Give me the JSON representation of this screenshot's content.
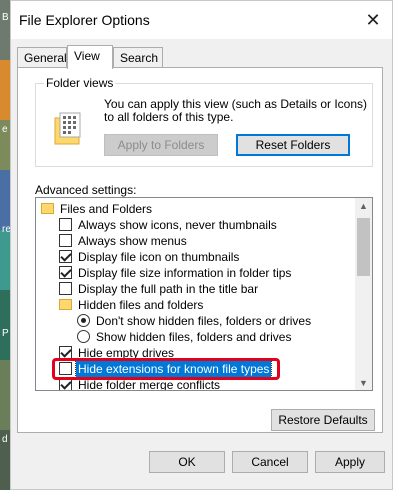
{
  "desktop": {
    "label_1": "B",
    "label_2": "e",
    "label_3": "re",
    "label_4": "P",
    "label_5": "d"
  },
  "window": {
    "title": "File Explorer Options",
    "close_glyph": "✕"
  },
  "tabs": [
    {
      "label": "General"
    },
    {
      "label": "View"
    },
    {
      "label": "Search"
    }
  ],
  "folder_views": {
    "legend": "Folder views",
    "description": "You can apply this view (such as Details or Icons) to all folders of this type.",
    "apply_button": "Apply to Folders",
    "reset_button": "Reset Folders"
  },
  "advanced": {
    "label": "Advanced settings:",
    "items": [
      {
        "text": "Files and Folders",
        "type": "folder"
      },
      {
        "text": "Always show icons, never thumbnails",
        "type": "checkbox",
        "checked": false
      },
      {
        "text": "Always show menus",
        "type": "checkbox",
        "checked": false
      },
      {
        "text": "Display file icon on thumbnails",
        "type": "checkbox",
        "checked": true
      },
      {
        "text": "Display file size information in folder tips",
        "type": "checkbox",
        "checked": true
      },
      {
        "text": "Display the full path in the title bar",
        "type": "checkbox",
        "checked": false
      },
      {
        "text": "Hidden files and folders",
        "type": "folder"
      },
      {
        "text": "Don't show hidden files, folders or drives",
        "type": "radio",
        "checked": true
      },
      {
        "text": "Show hidden files, folders and drives",
        "type": "radio",
        "checked": false
      },
      {
        "text": "Hide empty drives",
        "type": "checkbox",
        "checked": true
      },
      {
        "text": "Hide extensions for known file types",
        "type": "checkbox",
        "checked": false,
        "selected": true
      },
      {
        "text": "Hide folder merge conflicts",
        "type": "checkbox",
        "checked": true
      }
    ],
    "scroll_up": "▲",
    "scroll_down": "▼"
  },
  "buttons": {
    "restore_defaults": "Restore Defaults",
    "ok": "OK",
    "cancel": "Cancel",
    "apply": "Apply"
  },
  "colors": {
    "highlight_box": "#e2001a",
    "selection": "#0078d7"
  }
}
